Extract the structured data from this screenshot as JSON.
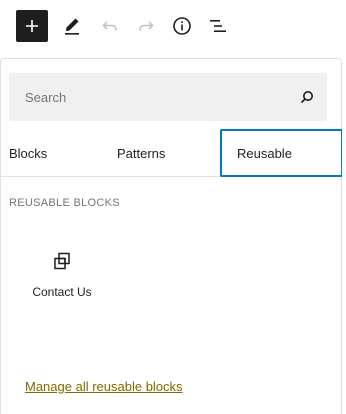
{
  "toolbar": {
    "inserter_icon": "plus-icon",
    "tools_icon": "pencil-icon",
    "undo_icon": "undo-icon",
    "redo_icon": "redo-icon",
    "details_icon": "info-icon",
    "outline_icon": "list-view-icon"
  },
  "search": {
    "placeholder": "Search",
    "value": "",
    "icon": "search-icon"
  },
  "tabs": [
    {
      "label": "Blocks",
      "selected": false
    },
    {
      "label": "Patterns",
      "selected": false
    },
    {
      "label": "Reusable",
      "selected": true
    }
  ],
  "reusable": {
    "section_title": "REUSABLE BLOCKS",
    "items": [
      {
        "label": "Contact Us",
        "icon": "reusable-block-icon"
      }
    ],
    "manage_link": "Manage all reusable blocks"
  },
  "colors": {
    "accent": "#007cba",
    "link": "#826a00",
    "inserter_bg": "#1e1e1e",
    "search_bg": "#f0f0f0"
  }
}
